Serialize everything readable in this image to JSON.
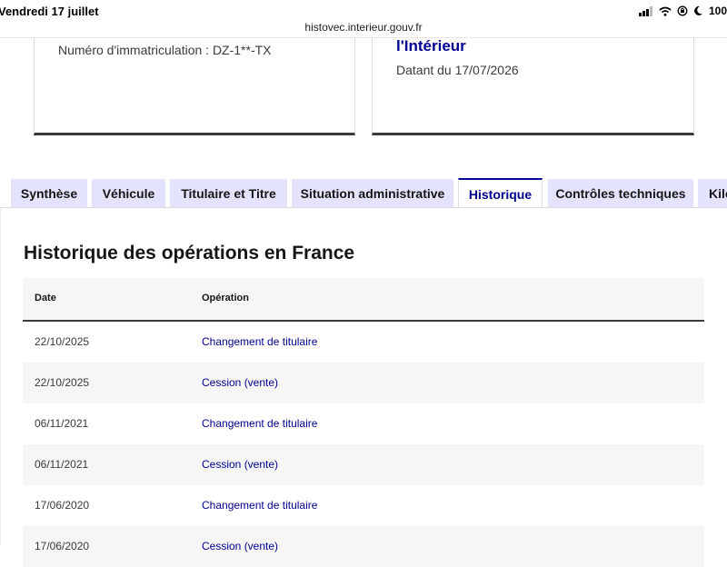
{
  "status_bar": {
    "time": "Vendredi 17 juillet",
    "battery": "100"
  },
  "browser": {
    "url": "histovec.interieur.gouv.fr"
  },
  "cards": {
    "left": {
      "registration": "Numéro d'immatriculation : DZ-1**-TX"
    },
    "right": {
      "title": "l'Intérieur",
      "date": "Datant du 17/07/2026"
    }
  },
  "tabs": [
    {
      "label": "Synthèse"
    },
    {
      "label": "Véhicule"
    },
    {
      "label": "Titulaire et Titre"
    },
    {
      "label": "Situation administrative"
    },
    {
      "label": "Historique",
      "active": true
    },
    {
      "label": "Contrôles techniques"
    },
    {
      "label": "Kilo"
    }
  ],
  "section": {
    "title": "Historique des opérations en France",
    "columns": {
      "date": "Date",
      "operation": "Opération"
    },
    "rows": [
      {
        "date": "22/10/2025",
        "operation": "Changement de titulaire"
      },
      {
        "date": "22/10/2025",
        "operation": "Cession (vente)"
      },
      {
        "date": "06/11/2021",
        "operation": "Changement de titulaire"
      },
      {
        "date": "06/11/2021",
        "operation": "Cession (vente)"
      },
      {
        "date": "17/06/2020",
        "operation": "Changement de titulaire"
      },
      {
        "date": "17/06/2020",
        "operation": "Cession (vente)"
      }
    ]
  },
  "colors": {
    "accent": "#000091",
    "tab_bg": "#e3e3fd",
    "row_alt": "#f6f6f6"
  }
}
